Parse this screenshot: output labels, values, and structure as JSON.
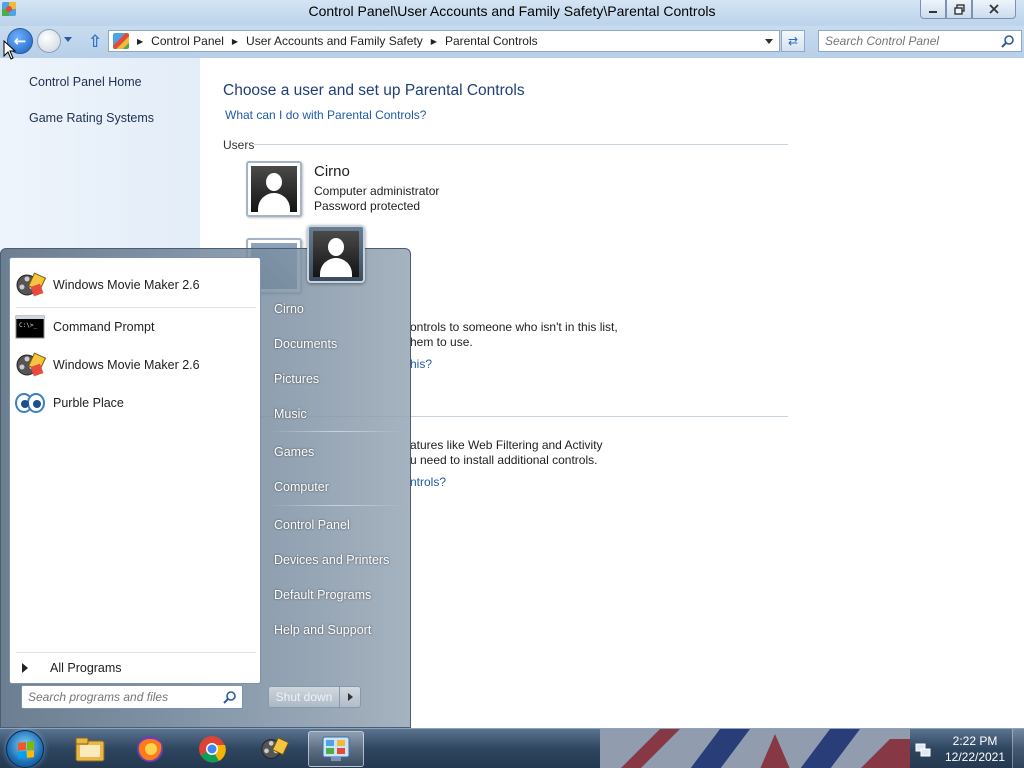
{
  "window": {
    "title": "Control Panel\\User Accounts and Family Safety\\Parental Controls"
  },
  "address_bar": {
    "crumbs": [
      "Control Panel",
      "User Accounts and Family Safety",
      "Parental Controls"
    ]
  },
  "search": {
    "placeholder": "Search Control Panel"
  },
  "left_pane": {
    "links": [
      "Control Panel Home",
      "Game Rating Systems"
    ]
  },
  "content": {
    "heading": "Choose a user and set up Parental Controls",
    "help_link": "What can I do with Parental Controls?",
    "users_label": "Users",
    "user": {
      "name": "Cirno",
      "role": "Computer administrator",
      "status": "Password protected"
    },
    "partial_texts": [
      "ontrols to someone who isn't in this list,",
      "hem to use.",
      "his?",
      "atures like Web Filtering and Activity",
      "u need to install additional controls.",
      "ntrols?"
    ]
  },
  "start_menu": {
    "programs": [
      {
        "label": "Windows Movie Maker 2.6",
        "icon": "movie-maker-icon"
      },
      {
        "label": "Command Prompt",
        "icon": "command-prompt-icon"
      },
      {
        "label": "Windows Movie Maker 2.6",
        "icon": "movie-maker-icon"
      },
      {
        "label": "Purble Place",
        "icon": "purble-place-icon"
      }
    ],
    "all_programs": "All Programs",
    "search_placeholder": "Search programs and files",
    "right_items": [
      "Cirno",
      "Documents",
      "Pictures",
      "Music",
      "Games",
      "Computer",
      "Control Panel",
      "Devices and Printers",
      "Default Programs",
      "Help and Support"
    ],
    "shutdown_label": "Shut down"
  },
  "taskbar": {
    "pinned": [
      "file-explorer-icon",
      "firefox-icon",
      "chrome-icon",
      "movie-maker-icon",
      "control-panel-icon"
    ],
    "time": "2:22 PM",
    "date": "12/22/2021"
  },
  "colors": {
    "link": "#1f5ba8",
    "heading": "#1e3f78",
    "taskbar": "#2f4660"
  }
}
